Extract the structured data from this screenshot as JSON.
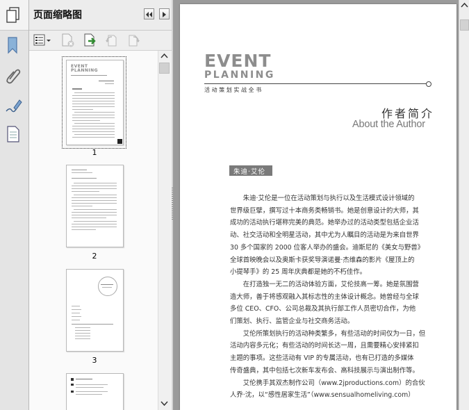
{
  "panel": {
    "title": "页面缩略图",
    "prev_icon": "rewind-icon",
    "next_icon": "play-icon"
  },
  "rail": {
    "icons": [
      "pages-icon",
      "bookmark-icon",
      "paperclip-icon",
      "signature-pen-icon",
      "document-layers-icon"
    ]
  },
  "toolbar": {
    "icons": [
      "options-menu-icon",
      "delete-page-icon",
      "insert-page-icon",
      "rotate-ccw-icon",
      "rotate-cw-icon"
    ]
  },
  "thumbnails": [
    {
      "label": "1",
      "selected": true
    },
    {
      "label": "2",
      "selected": false
    },
    {
      "label": "3",
      "selected": false
    },
    {
      "label": "",
      "selected": false
    }
  ],
  "document": {
    "logo_line1": "EVENT",
    "logo_line2": "PLANNING",
    "logo_sub": "活动策划实战全书",
    "heading_cn": "作者简介",
    "heading_en": "About the Author",
    "author_tag": "朱迪·艾伦",
    "paragraph_lines": [
      "　　朱迪·艾伦是一位在活动策划与执行以及生活模式设计领域的",
      "世界级巨擘，撰写过十本商务类畅销书。她是创意设计的大师，其",
      "成功的活动执行堪称完美的典范。她举办过的活动类型包括企业活",
      "动、社交活动和全明星活动，其中尤为人瞩目的活动是为来自世界",
      "30 多个国家的 2000 位客人举办的盛会。迪斯尼的《美女与野兽》",
      "全球首映晚会以及奥斯卡获奖导演诺曼·杰维森的影片《屋顶上的",
      "小提琴手》的 25 周年庆典都是她的不朽佳作。",
      "　　在打造独一无二的活动体验方面，艾伦技高一筹。她是氛围营",
      "造大师，善于将感观融入其标志性的主体设计概念。她曾经与全球",
      "多位 CEO、CFO、公司总裁及其执行部工作人员密切合作，为他",
      "们策划、执行、监管企业与社交商务活动。",
      "　　艾伦所策划执行的活动种类繁多，有些活动的时间仅为一日，但",
      "活动内容多元化；有些活动的时间长达一周，且需要精心安排紧扣",
      "主题的事项。这些活动有 VIP 的专属活动，也有已打造的多媒体",
      "传奇盛典，其中包括七次新车发布会、高科技展示与演出制作等。",
      "　　艾伦携手其双杰制作公司（www.2jproductions.com）的合伙",
      "人乔·沈，以“感性居家生活”（www.sensualhomeliving.com）"
    ]
  }
}
